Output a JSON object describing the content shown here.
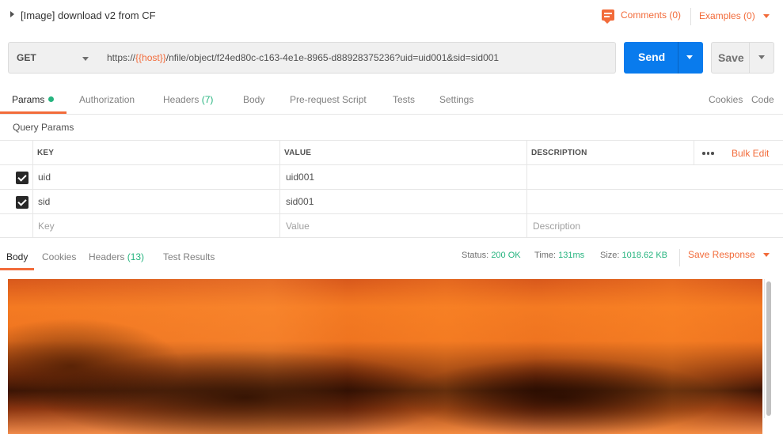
{
  "request": {
    "title": "[Image] download v2 from CF",
    "comments_label": "Comments (0)",
    "examples_label": "Examples (0)",
    "method": "GET",
    "url_prefix": "https://",
    "url_var": "{{host}}",
    "url_suffix": "/nfile/object/f24ed80c-c163-4e1e-8965-d88928375236?uid=uid001&sid=sid001",
    "send_label": "Send",
    "save_label": "Save"
  },
  "request_tabs": {
    "params": "Params",
    "authorization": "Authorization",
    "headers": "Headers",
    "headers_count": "(7)",
    "body": "Body",
    "prerequest": "Pre-request Script",
    "tests": "Tests",
    "settings": "Settings",
    "cookies": "Cookies",
    "code": "Code"
  },
  "query_params": {
    "label": "Query Params",
    "headers": {
      "key": "KEY",
      "value": "VALUE",
      "description": "DESCRIPTION"
    },
    "bulk_edit": "Bulk Edit",
    "rows": [
      {
        "key": "uid",
        "value": "uid001",
        "description": ""
      },
      {
        "key": "sid",
        "value": "sid001",
        "description": ""
      }
    ],
    "placeholders": {
      "key": "Key",
      "value": "Value",
      "description": "Description"
    }
  },
  "response": {
    "tabs": {
      "body": "Body",
      "cookies": "Cookies",
      "headers": "Headers",
      "headers_count": "(13)",
      "test_results": "Test Results"
    },
    "status_label": "Status:",
    "status_value": "200 OK",
    "time_label": "Time:",
    "time_value": "131ms",
    "size_label": "Size:",
    "size_value": "1018.62 KB",
    "save_response": "Save Response"
  },
  "colors": {
    "accent": "#f26b3a",
    "primary": "#097bed",
    "success": "#26b47f"
  }
}
